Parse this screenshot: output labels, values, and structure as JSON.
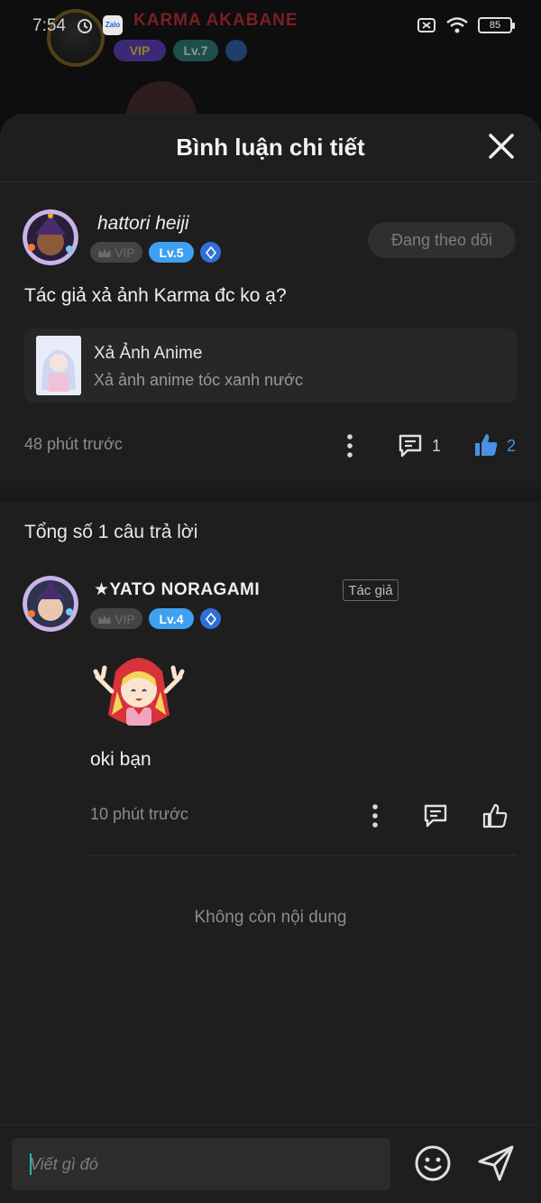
{
  "status_bar": {
    "time": "7:54",
    "zalo_label": "Zalo",
    "battery": "85"
  },
  "background_profile": {
    "name": "KARMA AKABANE",
    "vip": "VIP",
    "level": "Lv.7"
  },
  "sheet": {
    "title": "Bình luận chi tiết"
  },
  "comment": {
    "author": "hattori heiji",
    "vip": "VIP",
    "level": "Lv.5",
    "follow_label": "Đang theo dõi",
    "text": "Tác giả xả ảnh Karma đc ko ạ?",
    "ref_title": "Xả Ảnh Anime",
    "ref_subtitle": "Xả ảnh anime tóc xanh nước",
    "time": "48 phút trước",
    "reply_count": "1",
    "like_count": "2"
  },
  "replies": {
    "title": "Tổng số 1 câu trả lời",
    "items": [
      {
        "author": "★YATO NORAGAMI",
        "author_tag": "Tác giả",
        "vip": "VIP",
        "level": "Lv.4",
        "text": "oki bạn",
        "time": "10 phút trước"
      }
    ]
  },
  "end_text": "Không còn nội dung",
  "input": {
    "placeholder": "Viết gì đó"
  },
  "colors": {
    "sheet_bg": "#1e1e1e",
    "accent_blue": "#3fa0f0",
    "like_blue": "#4a90e2"
  }
}
